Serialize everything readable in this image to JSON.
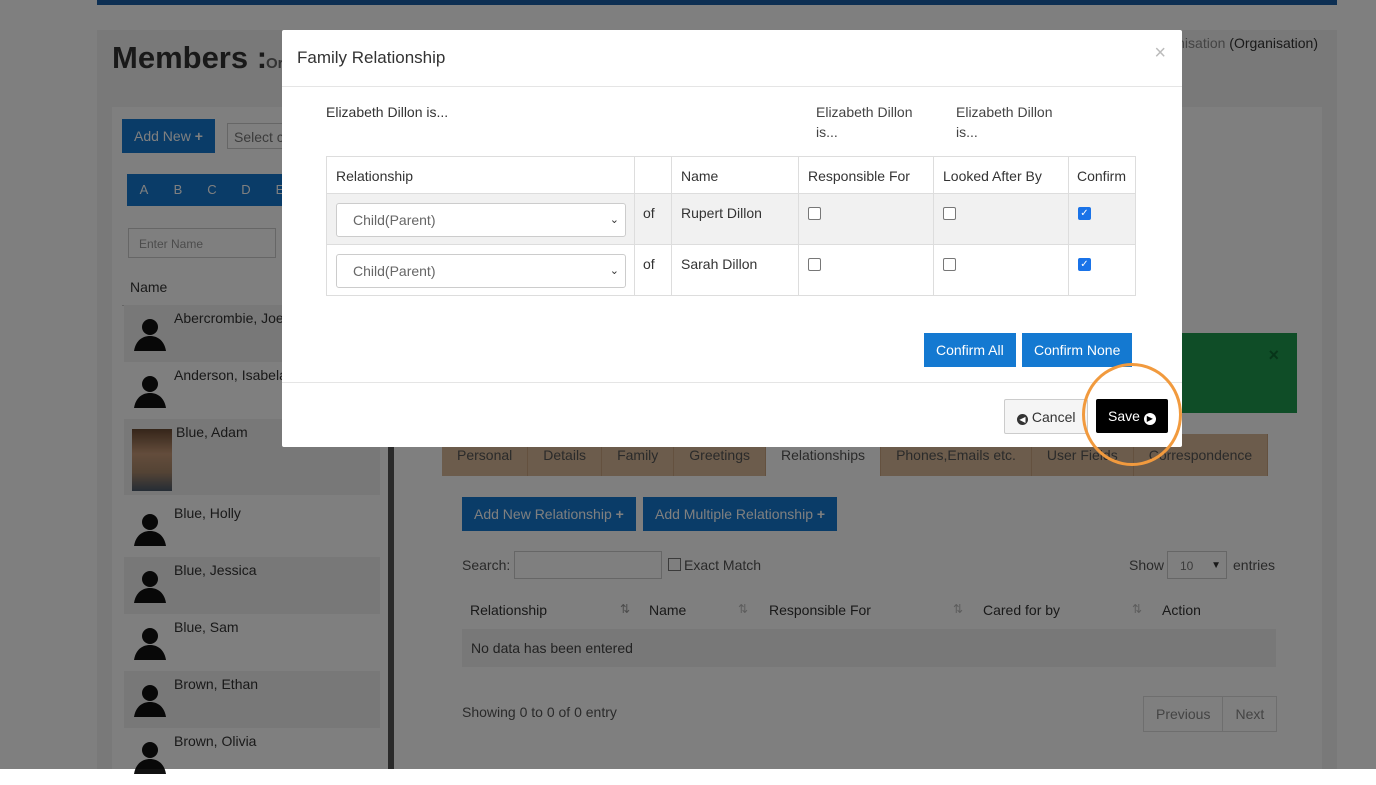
{
  "page": {
    "title": "Members :",
    "subtitle": "Or",
    "org_prefix": "nisation",
    "org_suffix": "(Organisation)"
  },
  "left": {
    "add_new_label": "Add New",
    "select_placeholder": "Select c",
    "alphabet": [
      "A",
      "B",
      "C",
      "D",
      "E"
    ],
    "name_placeholder": "Enter Name",
    "name_header": "Name",
    "members": [
      "Abercrombie, Joe",
      "Anderson, Isabela",
      "Blue, Adam",
      "Blue, Holly",
      "Blue, Jessica",
      "Blue, Sam",
      "Brown, Ethan",
      "Brown, Olivia"
    ]
  },
  "right": {
    "tabs": [
      "Personal",
      "Details",
      "Family",
      "Greetings",
      "Relationships",
      "Phones,Emails etc.",
      "User Fields",
      "Correspondence"
    ],
    "active_tab": "Relationships",
    "add_relationship_label": "Add New Relationship",
    "add_multiple_label": "Add Multiple Relationship",
    "search_label": "Search:",
    "exact_match_label": "Exact Match",
    "show_label": "Show",
    "entries_value": "10",
    "entries_label": "entries",
    "columns": [
      "Relationship",
      "Name",
      "Responsible For",
      "Cared for by",
      "Action"
    ],
    "empty_text": "No data has been entered",
    "showing_text": "Showing 0 to 0 of 0 entry",
    "prev_label": "Previous",
    "next_label": "Next"
  },
  "modal": {
    "title": "Family Relationship",
    "close_glyph": "×",
    "subject_is": "Elizabeth Dillon is...",
    "resp_is_line1": "Elizabeth Dillon",
    "resp_is_line2": "is...",
    "looked_is_line1": "Elizabeth Dillon",
    "looked_is_line2": "is...",
    "columns": {
      "relationship": "Relationship",
      "name": "Name",
      "responsible": "Responsible For",
      "looked_after": "Looked After By",
      "confirm": "Confirm"
    },
    "rows": [
      {
        "relationship": "Child(Parent)",
        "of": "of",
        "name": "Rupert Dillon",
        "responsible": false,
        "looked_after": false,
        "confirm": true
      },
      {
        "relationship": "Child(Parent)",
        "of": "of",
        "name": "Sarah Dillon",
        "responsible": false,
        "looked_after": false,
        "confirm": true
      }
    ],
    "confirm_all_label": "Confirm All",
    "confirm_none_label": "Confirm None",
    "cancel_label": "Cancel",
    "save_label": "Save"
  },
  "colors": {
    "primary_blue": "#1479d1",
    "tab_tan": "#d8b998",
    "success_green": "#1e9b4f",
    "highlight_orange": "#f19a3e"
  }
}
